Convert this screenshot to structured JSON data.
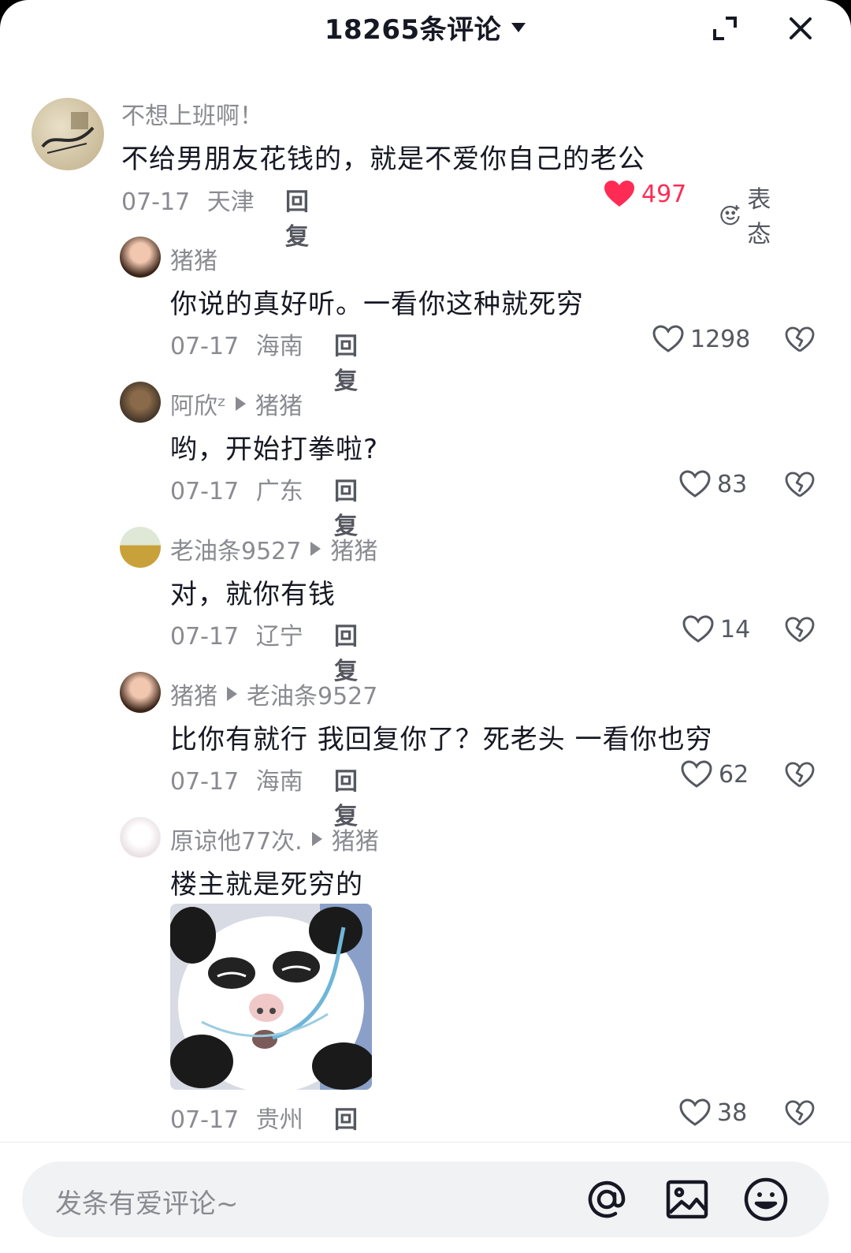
{
  "header": {
    "title": "18265条评论"
  },
  "comments": [
    {
      "user": "不想上班啊！",
      "text": "不给男朋友花钱的，就是不爱你自己的老公",
      "date": "07-17",
      "location": "天津",
      "reply_label": "回复",
      "likes": "497",
      "liked": true,
      "react_label": "表态"
    },
    {
      "user": "猪猪",
      "text": "你说的真好听。一看你这种就死穷",
      "date": "07-17",
      "location": "海南",
      "reply_label": "回复",
      "likes": "1298"
    },
    {
      "user": "阿欣ᶻ",
      "reply_to": "猪猪",
      "text": "哟，开始打拳啦?",
      "date": "07-17",
      "location": "广东",
      "reply_label": "回复",
      "likes": "83"
    },
    {
      "user": "老油条9527",
      "reply_to": "猪猪",
      "text": "对，就你有钱",
      "date": "07-17",
      "location": "辽宁",
      "reply_label": "回复",
      "likes": "14"
    },
    {
      "user": "猪猪",
      "reply_to": "老油条9527",
      "text": "比你有就行  我回复你了？死老头 一看你也穷",
      "date": "07-17",
      "location": "海南",
      "reply_label": "回复",
      "likes": "62"
    },
    {
      "user": "原谅他77次.",
      "reply_to": "猪猪",
      "text": "楼主就是死穷的",
      "date": "07-17",
      "location": "贵州",
      "reply_label": "回复",
      "likes": "38",
      "sticker": "panda-meme-sticker"
    }
  ],
  "input": {
    "placeholder": "发条有爱评论~"
  },
  "colors": {
    "like_red": "#fe2c55",
    "text_dark": "#161823",
    "text_gray": "#8a8b91"
  }
}
